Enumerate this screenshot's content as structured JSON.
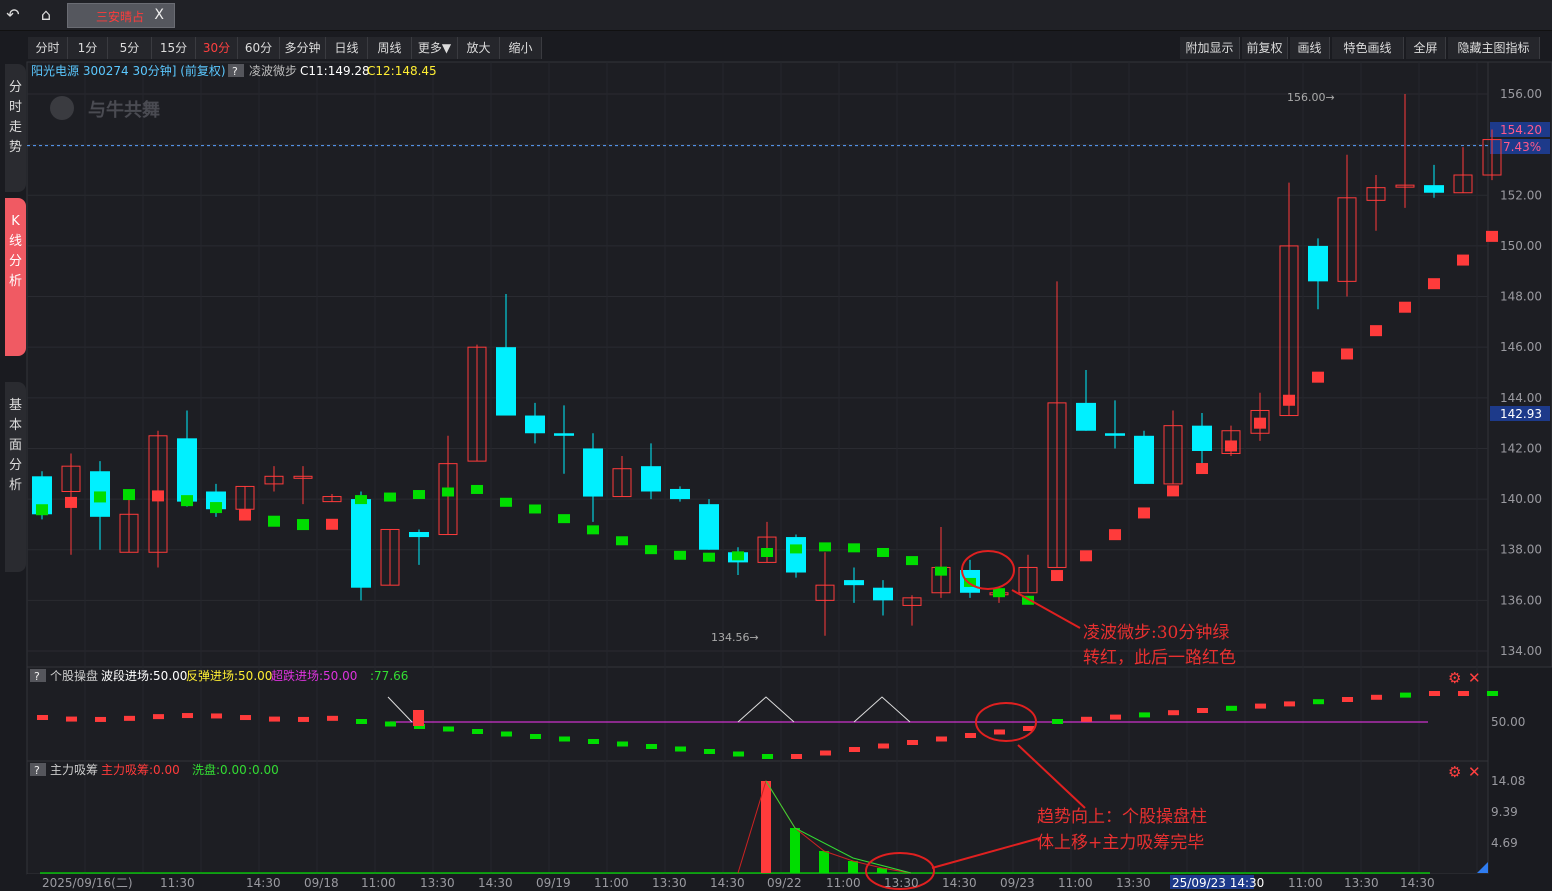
{
  "topbar": {
    "back_icon": "back-icon",
    "home_icon": "home-icon",
    "tab_title": "三安晴占",
    "tab_close": "X"
  },
  "toolbar": {
    "left": [
      "分时",
      "1分",
      "5分",
      "15分",
      "30分",
      "60分",
      "多分钟",
      "日线",
      "周线",
      "更多▼",
      "放大",
      "缩小"
    ],
    "active": "30分",
    "right": [
      "附加显示",
      "前复权",
      "画线",
      "特色画线",
      "全屏",
      "隐藏主图指标"
    ]
  },
  "sidebar": [
    {
      "label": "分时走势",
      "active": false
    },
    {
      "label": "K线分析",
      "active": true
    },
    {
      "label": "基本面分析",
      "active": false
    }
  ],
  "main_header": {
    "stock": "阳光电源 300274 30分钟] (前复权)",
    "help": "?",
    "indicator_name": "凌波微步",
    "c11": "C11:149.28",
    "c12": "C12:148.45",
    "watermark": "与牛共舞"
  },
  "price_axis": {
    "ticks": [
      "156.00",
      "154.00",
      "152.00",
      "150.00",
      "148.00",
      "146.00",
      "144.00",
      "142.00",
      "140.00",
      "138.00",
      "136.00",
      "134.00"
    ],
    "current_price": "154.20",
    "current_pct": "7.43%",
    "cursor_price": "142.93",
    "max_label": "156.00",
    "min_label": "134.56"
  },
  "sub1_header": {
    "help": "?",
    "name": "个股操盘",
    "a": "波段进场:50.00",
    "b": "反弹进场:50.00",
    "c": "超跌进场:50.00",
    "d": ":77.66",
    "axis": "50.00"
  },
  "sub2_header": {
    "help": "?",
    "name": "主力吸筹",
    "a": "主力吸筹:0.00",
    "b": "洗盘:0.00",
    "c": ":0.00",
    "axis": [
      "14.08",
      "9.39",
      "4.69"
    ]
  },
  "time_axis": [
    "2025/09/16(二)",
    "11:30",
    "14:30",
    "09/18",
    "11:00",
    "13:30",
    "14:30",
    "09/19",
    "11:00",
    "13:30",
    "14:30",
    "09/22",
    "11:00",
    "13:30",
    "14:30",
    "09/23",
    "11:00",
    "13:30",
    "25/09/23 14:30",
    "11:00",
    "13:30",
    "14:30"
  ],
  "annotations": {
    "note1_line1": "凌波微步:30分钟绿",
    "note1_line2": "转红，此后一路红色",
    "note2_line1": "趋势向上：个股操盘柱",
    "note2_line2": "体上移+主力吸筹完毕"
  },
  "colors": {
    "up": "#ff3b3b",
    "down": "#00f0ff",
    "green": "#00dd00",
    "purple": "#cc33cc",
    "accent": "#1d3a8a"
  },
  "chart_data": {
    "type": "candlestick",
    "y_range": [
      134,
      156.6
    ],
    "candles": [
      [
        140.9,
        139.4,
        141.1,
        139.2
      ],
      [
        140.3,
        141.3,
        141.8,
        137.8
      ],
      [
        141.1,
        139.3,
        141.5,
        138.0
      ],
      [
        137.9,
        139.4,
        140.3,
        137.9
      ],
      [
        137.9,
        142.5,
        142.7,
        137.3
      ],
      [
        142.4,
        139.9,
        143.5,
        139.7
      ],
      [
        140.3,
        139.6,
        140.6,
        139.3
      ],
      [
        139.6,
        140.5,
        140.5,
        139.6
      ],
      [
        140.6,
        140.9,
        141.3,
        140.3
      ],
      [
        140.9,
        140.9,
        141.3,
        139.8
      ],
      [
        139.9,
        140.1,
        140.2,
        139.9
      ],
      [
        140.0,
        136.5,
        140.3,
        136.0
      ],
      [
        136.6,
        138.8,
        138.8,
        136.6
      ],
      [
        138.7,
        138.5,
        138.8,
        137.4
      ],
      [
        138.6,
        141.4,
        142.5,
        138.6
      ],
      [
        141.5,
        146.0,
        146.1,
        141.5
      ],
      [
        146.0,
        143.3,
        148.1,
        143.3
      ],
      [
        143.3,
        142.6,
        143.8,
        142.2
      ],
      [
        142.6,
        142.5,
        143.7,
        141.0
      ],
      [
        142.0,
        140.1,
        142.6,
        139.1
      ],
      [
        140.1,
        141.2,
        141.7,
        140.1
      ],
      [
        141.3,
        140.3,
        142.2,
        140.0
      ],
      [
        140.4,
        140.0,
        140.5,
        139.9
      ],
      [
        139.8,
        138.0,
        140.0,
        138.0
      ],
      [
        137.9,
        137.5,
        138.1,
        137.0
      ],
      [
        137.5,
        138.5,
        139.1,
        137.5
      ],
      [
        138.5,
        137.1,
        138.6,
        136.9
      ],
      [
        136.0,
        136.6,
        137.9,
        134.6
      ],
      [
        136.8,
        136.6,
        137.3,
        135.9
      ],
      [
        136.5,
        136.0,
        136.8,
        135.4
      ],
      [
        135.8,
        136.1,
        136.2,
        135.0
      ],
      [
        136.3,
        137.3,
        138.9,
        136.1
      ],
      [
        137.2,
        136.3,
        137.6,
        136.1
      ],
      [
        136.3,
        136.3,
        136.5,
        135.9
      ],
      [
        136.3,
        137.3,
        137.8,
        136.3
      ],
      [
        137.3,
        143.8,
        148.6,
        137.3
      ],
      [
        143.8,
        142.7,
        145.1,
        142.7
      ],
      [
        142.6,
        142.5,
        143.9,
        142.0
      ],
      [
        142.5,
        140.6,
        142.7,
        140.6
      ],
      [
        140.6,
        142.9,
        143.5,
        140.6
      ],
      [
        142.9,
        141.9,
        143.4,
        141.1
      ],
      [
        141.8,
        142.7,
        142.9,
        141.7
      ],
      [
        142.6,
        143.5,
        144.2,
        142.3
      ],
      [
        143.3,
        150.0,
        152.5,
        143.3
      ],
      [
        150.0,
        148.6,
        150.3,
        147.5
      ],
      [
        148.6,
        151.9,
        153.6,
        148.0
      ],
      [
        151.8,
        152.3,
        152.8,
        150.6
      ],
      [
        152.4,
        152.4,
        156.0,
        151.5
      ],
      [
        152.4,
        152.1,
        153.2,
        151.9
      ],
      [
        152.1,
        152.8,
        153.9,
        152.1
      ],
      [
        152.8,
        154.2,
        154.6,
        152.6
      ]
    ],
    "lbwb_color_change_index": 35
  }
}
